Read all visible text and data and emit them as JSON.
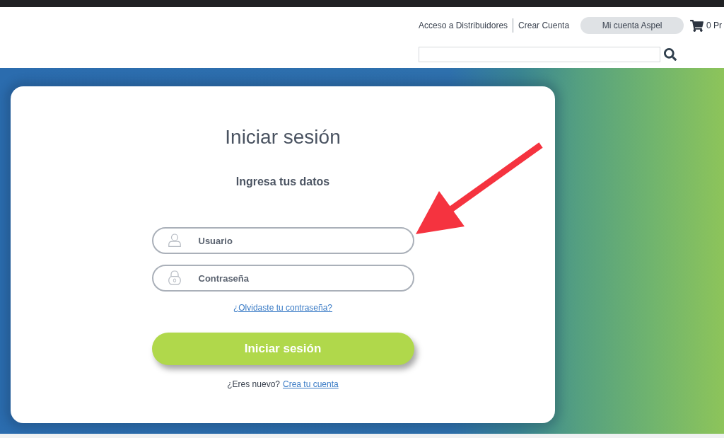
{
  "header": {
    "links": [
      {
        "label": "Acceso a Distribuidores"
      },
      {
        "label": "Crear Cuenta"
      }
    ],
    "account_button": "Mi cuenta Aspel",
    "cart": {
      "label": "0 Pr"
    }
  },
  "login": {
    "title": "Iniciar sesión",
    "subtitle": "Ingresa tus datos",
    "fields": [
      {
        "kind": "user",
        "placeholder": "Usuario"
      },
      {
        "kind": "password",
        "placeholder": "Contraseña"
      }
    ],
    "forgot_link": "¿Olvidaste tu contraseña?",
    "submit_button": "Iniciar sesión",
    "signup": {
      "prompt": "¿Eres nuevo?",
      "link": "Crea tu cuenta"
    }
  }
}
